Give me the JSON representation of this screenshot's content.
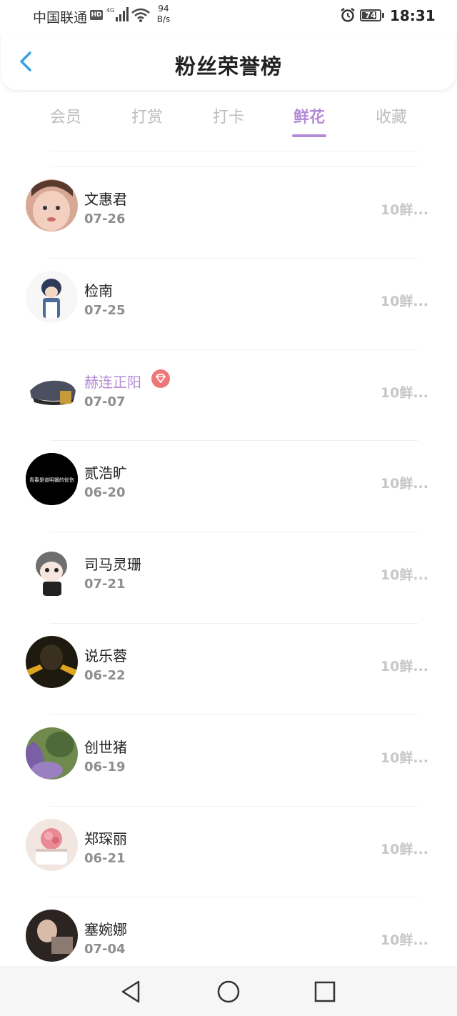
{
  "status_bar": {
    "carrier": "中国联通",
    "hd": "HD",
    "network_speed_value": "94",
    "network_speed_unit": "B/s",
    "battery": "74",
    "time": "18:31"
  },
  "header": {
    "title": "粉丝荣誉榜"
  },
  "tabs": [
    {
      "label": "会员",
      "active": false
    },
    {
      "label": "打赏",
      "active": false
    },
    {
      "label": "打卡",
      "active": false
    },
    {
      "label": "鲜花",
      "active": true
    },
    {
      "label": "收藏",
      "active": false
    }
  ],
  "list": [
    {
      "name": "文惠君",
      "date": "07-26",
      "amount": "10鲜...",
      "vip": false,
      "avatar_color": "#e8b7a4"
    },
    {
      "name": "检南",
      "date": "07-25",
      "amount": "10鲜...",
      "vip": false,
      "avatar_color": "#5c6f8c"
    },
    {
      "name": "赫连正阳",
      "date": "07-07",
      "amount": "10鲜...",
      "vip": true,
      "avatar_color": "#4a4f5a"
    },
    {
      "name": "贰浩旷",
      "date": "06-20",
      "amount": "10鲜...",
      "vip": false,
      "avatar_color": "#000000",
      "avatar_caption": "青春是道明媚的忧伤"
    },
    {
      "name": "司马灵珊",
      "date": "07-21",
      "amount": "10鲜...",
      "vip": false,
      "avatar_color": "#6d6d6d"
    },
    {
      "name": "说乐蓉",
      "date": "06-22",
      "amount": "10鲜...",
      "vip": false,
      "avatar_color": "#2d2414"
    },
    {
      "name": "创世猪",
      "date": "06-19",
      "amount": "10鲜...",
      "vip": false,
      "avatar_color": "#7b6a9a"
    },
    {
      "name": "郑琛丽",
      "date": "06-21",
      "amount": "10鲜...",
      "vip": false,
      "avatar_color": "#e9a4a8"
    },
    {
      "name": "塞婉娜",
      "date": "07-04",
      "amount": "10鲜...",
      "vip": false,
      "avatar_color": "#3a2e2a"
    }
  ],
  "colors": {
    "accent": "#b48ad6",
    "vip_badge": "#f07777",
    "back_arrow": "#3aa0e6"
  },
  "icons": {
    "back": "chevron-left-icon",
    "nav_back": "triangle-back-icon",
    "nav_home": "circle-home-icon",
    "nav_recents": "square-recents-icon"
  }
}
